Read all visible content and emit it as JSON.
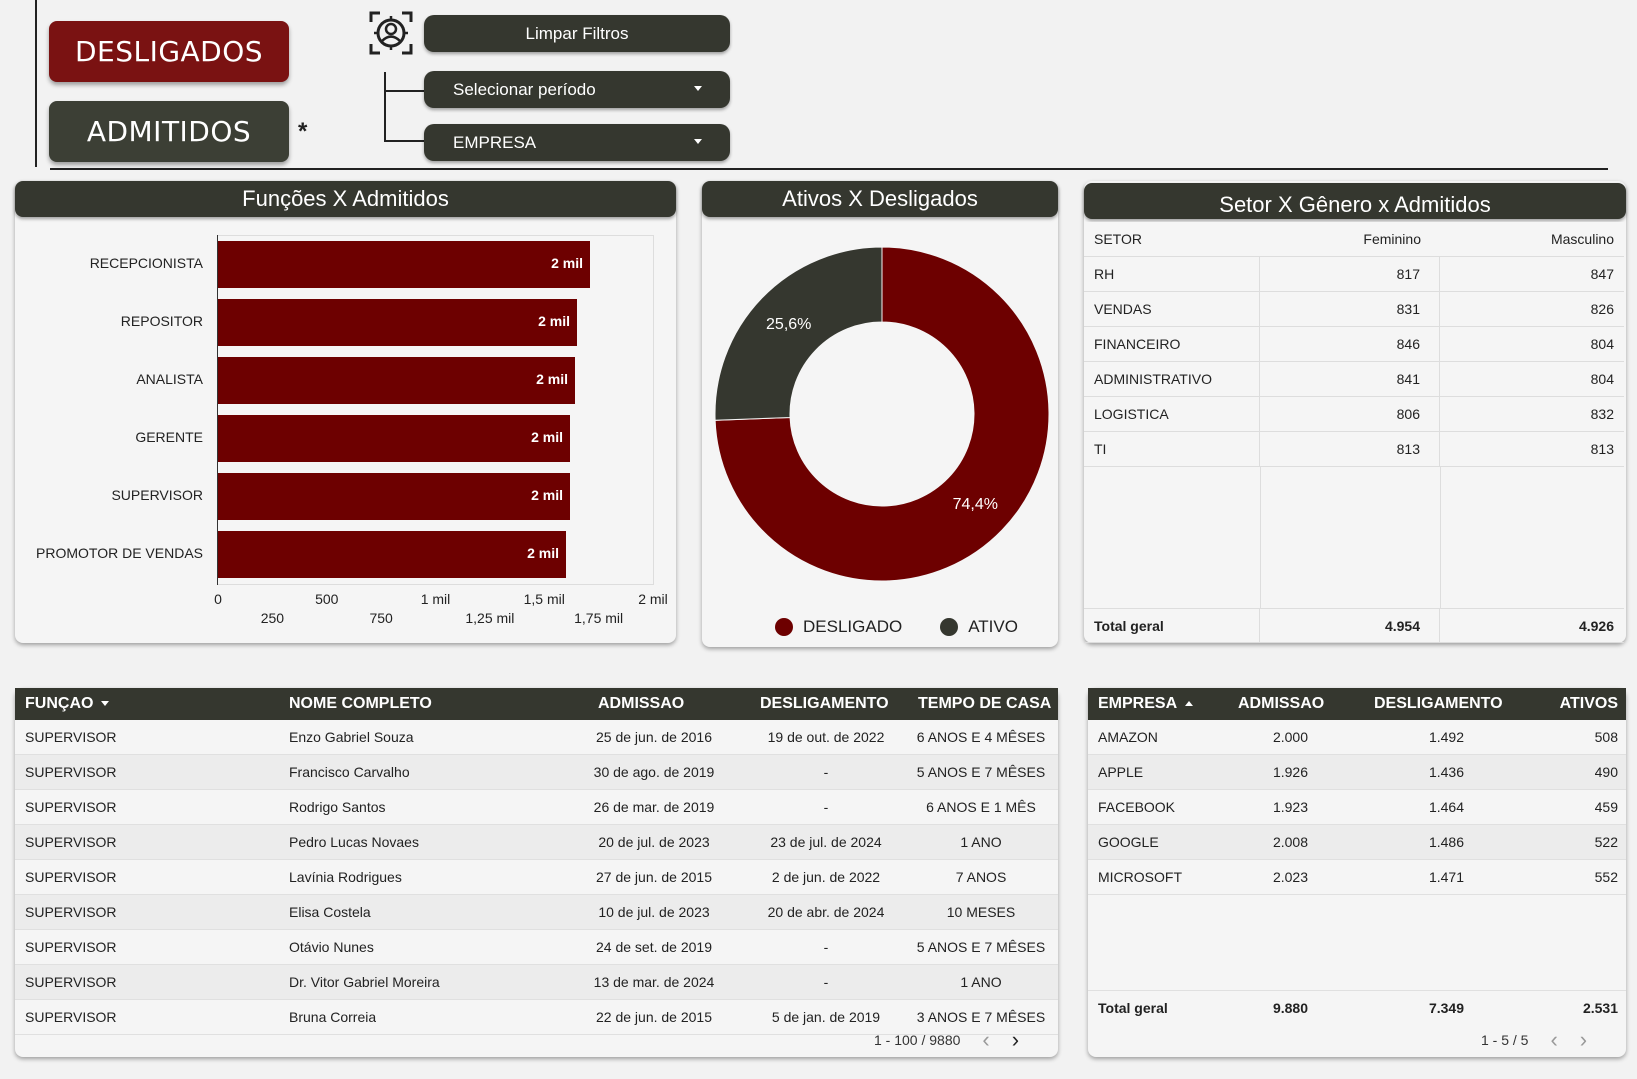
{
  "buttons": {
    "desligados": "DESLIGADOS",
    "admitidos": "ADMITIDOS",
    "asterisk": "*"
  },
  "filters": {
    "clear": "Limpar Filtros",
    "period": "Selecionar período",
    "company": "EMPRESA"
  },
  "funcoes_chart": {
    "title": "Funções X Admitidos",
    "chart_data": {
      "type": "bar",
      "orientation": "horizontal",
      "categories": [
        "RECEPCIONISTA",
        "REPOSITOR",
        "ANALISTA",
        "GERENTE",
        "SUPERVISOR",
        "PROMOTOR DE VENDAS"
      ],
      "values": [
        1710,
        1650,
        1640,
        1620,
        1620,
        1600
      ],
      "data_labels": [
        "2 mil",
        "2 mil",
        "2 mil",
        "2 mil",
        "2 mil",
        "2 mil"
      ],
      "xlim": [
        0,
        2000
      ],
      "ticks_top": [
        "0",
        "500",
        "1 mil",
        "1,5 mil",
        "2 mil"
      ],
      "ticks_bottom": [
        "250",
        "750",
        "1,25 mil",
        "1,75 mil"
      ],
      "color": "#6d0000"
    }
  },
  "ativos_chart": {
    "title": "Ativos X Desligados",
    "chart_data": {
      "type": "pie",
      "donut": true,
      "labels": [
        "DESLIGADO",
        "ATIVO"
      ],
      "values": [
        74.4,
        25.6
      ],
      "data_labels": [
        "74,4%",
        "25,6%"
      ],
      "colors": [
        "#6d0000",
        "#35372f"
      ]
    }
  },
  "setor_table": {
    "title": "Setor X Gênero x Admitidos",
    "headers": [
      "SETOR",
      "Feminino",
      "Masculino"
    ],
    "rows": [
      [
        "RH",
        "817",
        "847"
      ],
      [
        "VENDAS",
        "831",
        "826"
      ],
      [
        "FINANCEIRO",
        "846",
        "804"
      ],
      [
        "ADMINISTRATIVO",
        "841",
        "804"
      ],
      [
        "LOGISTICA",
        "806",
        "832"
      ],
      [
        "TI",
        "813",
        "813"
      ]
    ],
    "total": [
      "Total geral",
      "4.954",
      "4.926"
    ]
  },
  "funcoes_table": {
    "headers": [
      "FUNÇAO",
      "NOME COMPLETO",
      "ADMISSAO",
      "DESLIGAMENTO",
      "TEMPO DE CASA"
    ],
    "rows": [
      [
        "SUPERVISOR",
        "Enzo Gabriel Souza",
        "25 de jun. de 2016",
        "19 de out. de 2022",
        "6 ANOS E 4 MÊSES"
      ],
      [
        "SUPERVISOR",
        "Francisco Carvalho",
        "30 de ago. de 2019",
        "-",
        "5 ANOS E 7 MÊSES"
      ],
      [
        "SUPERVISOR",
        "Rodrigo Santos",
        "26 de mar. de 2019",
        "-",
        "6 ANOS E 1 MÊS"
      ],
      [
        "SUPERVISOR",
        "Pedro Lucas Novaes",
        "20 de jul. de 2023",
        "23 de jul. de 2024",
        "1 ANO"
      ],
      [
        "SUPERVISOR",
        "Lavínia Rodrigues",
        "27 de jun. de 2015",
        "2 de jun. de 2022",
        "7 ANOS"
      ],
      [
        "SUPERVISOR",
        "Elisa Costela",
        "10 de jul. de 2023",
        "20 de abr. de 2024",
        "10 MESES"
      ],
      [
        "SUPERVISOR",
        "Otávio Nunes",
        "24 de set. de 2019",
        "-",
        "5 ANOS E 7 MÊSES"
      ],
      [
        "SUPERVISOR",
        "Dr. Vitor Gabriel Moreira",
        "13 de mar. de 2024",
        "-",
        "1 ANO"
      ],
      [
        "SUPERVISOR",
        "Bruna Correia",
        "22 de jun. de 2015",
        "5 de jan. de 2019",
        "3 ANOS E 7 MÊSES"
      ]
    ],
    "pagination": "1 - 100 / 9880"
  },
  "empresa_table": {
    "headers": [
      "EMPRESA",
      "ADMISSAO",
      "DESLIGAMENTO",
      "ATIVOS"
    ],
    "rows": [
      [
        "AMAZON",
        "2.000",
        "1.492",
        "508"
      ],
      [
        "APPLE",
        "1.926",
        "1.436",
        "490"
      ],
      [
        "FACEBOOK",
        "1.923",
        "1.464",
        "459"
      ],
      [
        "GOOGLE",
        "2.008",
        "1.486",
        "522"
      ],
      [
        "MICROSOFT",
        "2.023",
        "1.471",
        "552"
      ]
    ],
    "total": [
      "Total geral",
      "9.880",
      "7.349",
      "2.531"
    ],
    "pagination": "1 - 5 / 5"
  },
  "colors": {
    "accent_red": "#7a1212",
    "dark_olive": "#35372f",
    "bar_red": "#6d0000"
  },
  "icons": {
    "filter": "user-scan-icon",
    "prev": "chevron-left-icon",
    "next": "chevron-right-icon"
  }
}
